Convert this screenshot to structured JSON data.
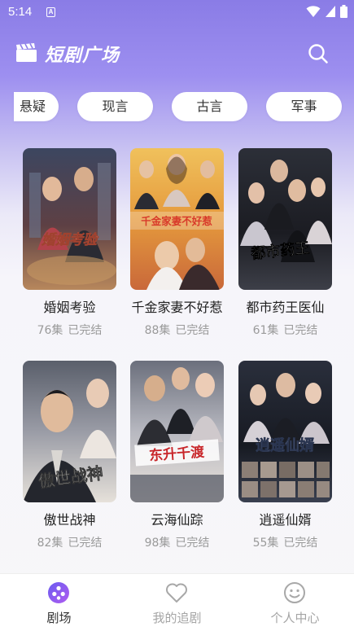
{
  "status_bar": {
    "time": "5:14",
    "app_badge": "A"
  },
  "header": {
    "title": "短剧广场",
    "icons": [
      "clapperboard-icon",
      "search-icon"
    ]
  },
  "genres": [
    "悬疑",
    "现言",
    "古言",
    "军事"
  ],
  "dramas": [
    {
      "title": "婚姻考验",
      "episodes": "76集",
      "status": "已完结",
      "poster_text": "婚姻考验",
      "poster_colors": [
        "#2b2f3d",
        "#7a4a4a",
        "#c99a6a"
      ]
    },
    {
      "title": "千金家妻不好惹",
      "episodes": "88集",
      "status": "已完结",
      "poster_text": "千金家妻不好惹",
      "poster_colors": [
        "#d88a3a",
        "#f3c36a",
        "#6b3a22"
      ]
    },
    {
      "title": "都市药王医仙",
      "episodes": "61集",
      "status": "已完结",
      "poster_text": "都市药王",
      "poster_colors": [
        "#1d1f26",
        "#4a4d58",
        "#b8b9c4"
      ]
    },
    {
      "title": "傲世战神",
      "episodes": "82集",
      "status": "已完结",
      "poster_text": "傲世战神",
      "poster_colors": [
        "#3a3d47",
        "#8b8f9a",
        "#d8d2cc"
      ]
    },
    {
      "title": "云海仙踪",
      "episodes": "98集",
      "status": "已完结",
      "poster_text": "东升千渡",
      "poster_colors": [
        "#4a4f5c",
        "#a9aab3",
        "#e0d6cf"
      ]
    },
    {
      "title": "逍遥仙婿",
      "episodes": "55集",
      "status": "已完结",
      "poster_text": "逍遥仙婿",
      "poster_colors": [
        "#151923",
        "#3c4250",
        "#8c93a6"
      ]
    }
  ],
  "bottom_nav": [
    {
      "label": "剧场",
      "icon": "theater-icon",
      "active": true
    },
    {
      "label": "我的追剧",
      "icon": "heart-icon",
      "active": false
    },
    {
      "label": "个人中心",
      "icon": "smiley-icon",
      "active": false
    }
  ],
  "colors": {
    "accent": "#7b6cf0",
    "header_gradient_top": "#8a7ce6",
    "meta_text": "#9a9a9a"
  }
}
